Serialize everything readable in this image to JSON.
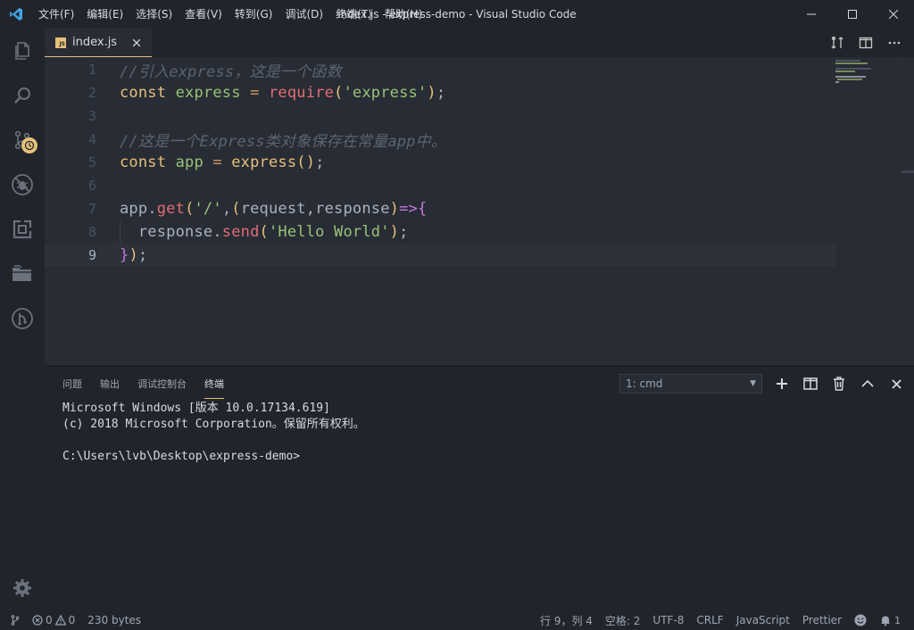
{
  "window": {
    "title": "index.js - express-demo - Visual Studio Code",
    "menu": [
      "文件(F)",
      "编辑(E)",
      "选择(S)",
      "查看(V)",
      "转到(G)",
      "调试(D)",
      "终端(T)",
      "帮助(H)"
    ]
  },
  "activity_bar": {
    "items": [
      "explorer-icon",
      "search-icon",
      "source-control-icon",
      "debug-icon",
      "extensions-icon",
      "folder-icon",
      "git-icon"
    ],
    "settings_icon": "gear-icon"
  },
  "tab": {
    "badge": "JS",
    "label": "index.js",
    "close": "×"
  },
  "editor": {
    "lines": [
      {
        "number": "1",
        "text": "//引入express，这是一个函数"
      },
      {
        "number": "2",
        "text": "const express = require('express');"
      },
      {
        "number": "3",
        "text": ""
      },
      {
        "number": "4",
        "text": "//这是一个Express类对象保存在常量app中。"
      },
      {
        "number": "5",
        "text": "const app = express();"
      },
      {
        "number": "6",
        "text": ""
      },
      {
        "number": "7",
        "text": "app.get('/',(request,response)=>{"
      },
      {
        "number": "8",
        "text": "  response.send('Hello World');"
      },
      {
        "number": "9",
        "text": "});"
      }
    ],
    "current_line": 9
  },
  "panel": {
    "tabs": [
      "问题",
      "输出",
      "调试控制台",
      "终端"
    ],
    "active_tab": "终端",
    "terminal_select": "1: cmd",
    "terminal_lines": [
      "Microsoft Windows [版本 10.0.17134.619]",
      "(c) 2018 Microsoft Corporation。保留所有权利。",
      "",
      "C:\\Users\\lvb\\Desktop\\express-demo>"
    ]
  },
  "status_bar": {
    "errors": "0",
    "warnings": "0",
    "file_size": "230 bytes",
    "position": "行 9，列 4",
    "indent": "空格: 2",
    "encoding": "UTF-8",
    "eol": "CRLF",
    "language": "JavaScript",
    "formatter": "Prettier"
  },
  "colors": {
    "background": "#282c34",
    "chrome": "#21252b",
    "accent": "#e5c07b",
    "string": "#98c379",
    "keyword": "#e5c07b",
    "function": "#e06c75",
    "comment": "#5c6370"
  }
}
